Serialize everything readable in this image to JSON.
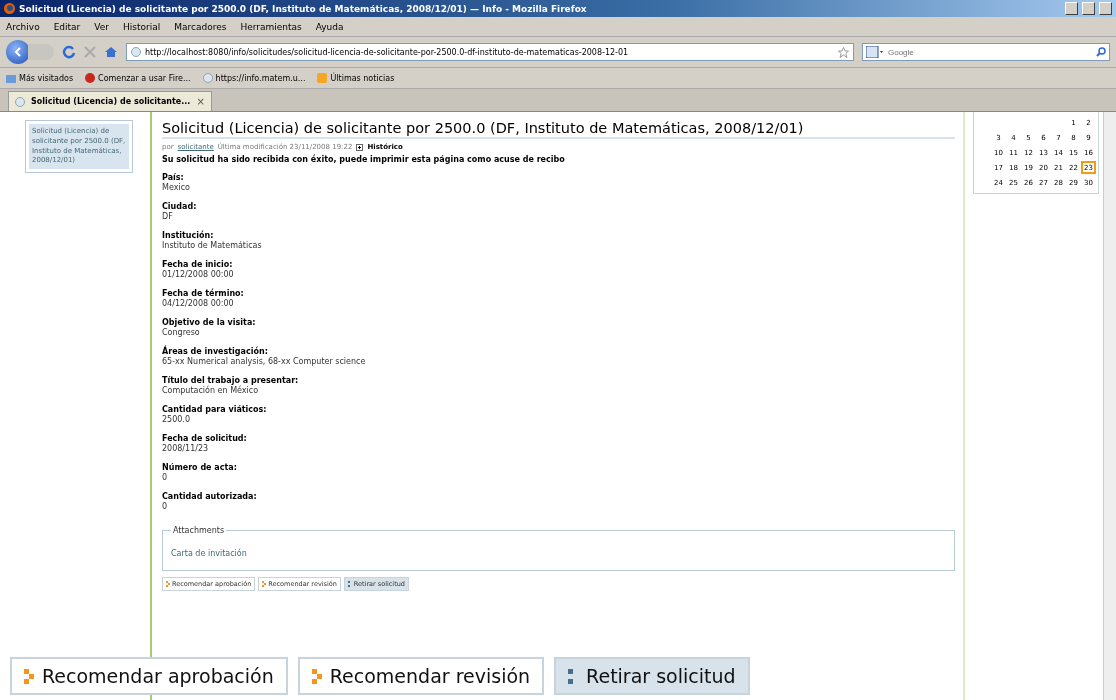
{
  "window": {
    "title": "Solicitud (Licencia) de solicitante por 2500.0 (DF, Instituto de Matemáticas, 2008/12/01) — Info - Mozilla Firefox"
  },
  "menu": [
    "Archivo",
    "Editar",
    "Ver",
    "Historial",
    "Marcadores",
    "Herramientas",
    "Ayuda"
  ],
  "address": {
    "url": "http://localhost:8080/info/solicitudes/solicitud-licencia-de-solicitante-por-2500.0-df-instituto-de-matematicas-2008-12-01"
  },
  "search": {
    "placeholder": "Google"
  },
  "bookmarks": [
    {
      "label": "Más visitados",
      "kind": "folder"
    },
    {
      "label": "Comenzar a usar Fire...",
      "kind": "firefox"
    },
    {
      "label": "https://info.matem.u...",
      "kind": "page"
    },
    {
      "label": "Últimas noticias",
      "kind": "feed"
    }
  ],
  "tabs": [
    {
      "label": "Solicitud (Licencia) de solicitante...",
      "close": "×",
      "selected": true
    }
  ],
  "sidebar": {
    "items": [
      {
        "label": "Solicitud (Licencia) de solicitante por 2500.0 (DF, Instituto de Matemáticas, 2008/12/01)",
        "selected": true
      }
    ]
  },
  "document": {
    "title": "Solicitud (Licencia) de solicitante por 2500.0 (DF, Instituto de Matemáticas, 2008/12/01)",
    "byline": {
      "prefix": "por",
      "author": "solicitante",
      "modified": "Última modificación 23/11/2008 19:22",
      "history": "Histórico"
    },
    "message": "Su solicitud ha sido recibida con éxito, puede imprimir esta página como acuse de recibo",
    "fields": [
      {
        "label": "País:",
        "value": "Mexico"
      },
      {
        "label": "Ciudad:",
        "value": "DF"
      },
      {
        "label": "Institución:",
        "value": "Instituto de Matemáticas"
      },
      {
        "label": "Fecha de inicio:",
        "value": "01/12/2008 00:00"
      },
      {
        "label": "Fecha de término:",
        "value": "04/12/2008 00:00"
      },
      {
        "label": "Objetivo de la visita:",
        "value": "Congreso"
      },
      {
        "label": "Áreas de investigación:",
        "value": "65-xx Numerical analysis, 68-xx Computer science"
      },
      {
        "label": "Título del trabajo a presentar:",
        "value": "Computación en México"
      },
      {
        "label": "Cantidad para viáticos:",
        "value": "2500.0"
      },
      {
        "label": "Fecha de solicitud:",
        "value": "2008/11/23"
      },
      {
        "label": "Número de acta:",
        "value": "0"
      },
      {
        "label": "Cantidad autorizada:",
        "value": "0"
      }
    ],
    "attachments": {
      "legend": "Attachments",
      "items": [
        "Carta de invitación"
      ]
    },
    "actions": [
      {
        "label": "Recomendar aprobación",
        "kind": "recommend"
      },
      {
        "label": "Recomendar revisión",
        "kind": "recommend"
      },
      {
        "label": "Retirar solicitud",
        "kind": "withdraw"
      }
    ]
  },
  "calendar": {
    "weeks": [
      [
        {
          "day": "1",
          "selected": false
        },
        {
          "day": "2",
          "selected": false
        }
      ],
      [
        {
          "day": "3",
          "selected": false
        },
        {
          "day": "4",
          "selected": false
        },
        {
          "day": "5",
          "selected": false
        },
        {
          "day": "6",
          "selected": false
        },
        {
          "day": "7",
          "selected": false
        },
        {
          "day": "8",
          "selected": false
        },
        {
          "day": "9",
          "selected": false
        }
      ],
      [
        {
          "day": "10",
          "selected": false
        },
        {
          "day": "11",
          "selected": false
        },
        {
          "day": "12",
          "selected": false
        },
        {
          "day": "13",
          "selected": false
        },
        {
          "day": "14",
          "selected": false
        },
        {
          "day": "15",
          "selected": false
        },
        {
          "day": "16",
          "selected": false
        }
      ],
      [
        {
          "day": "17",
          "selected": false
        },
        {
          "day": "18",
          "selected": false
        },
        {
          "day": "19",
          "selected": false
        },
        {
          "day": "20",
          "selected": false
        },
        {
          "day": "21",
          "selected": false
        },
        {
          "day": "22",
          "selected": false
        },
        {
          "day": "23",
          "selected": true
        }
      ],
      [
        {
          "day": "24",
          "selected": false
        },
        {
          "day": "25",
          "selected": false
        },
        {
          "day": "26",
          "selected": false
        },
        {
          "day": "27",
          "selected": false
        },
        {
          "day": "28",
          "selected": false
        },
        {
          "day": "29",
          "selected": false
        },
        {
          "day": "30",
          "selected": false
        }
      ]
    ]
  },
  "enlarged_actions": [
    {
      "label": "Recomendar aprobación",
      "kind": "recommend"
    },
    {
      "label": "Recomendar revisión",
      "kind": "recommend"
    },
    {
      "label": "Retirar solicitud",
      "kind": "withdraw"
    }
  ]
}
